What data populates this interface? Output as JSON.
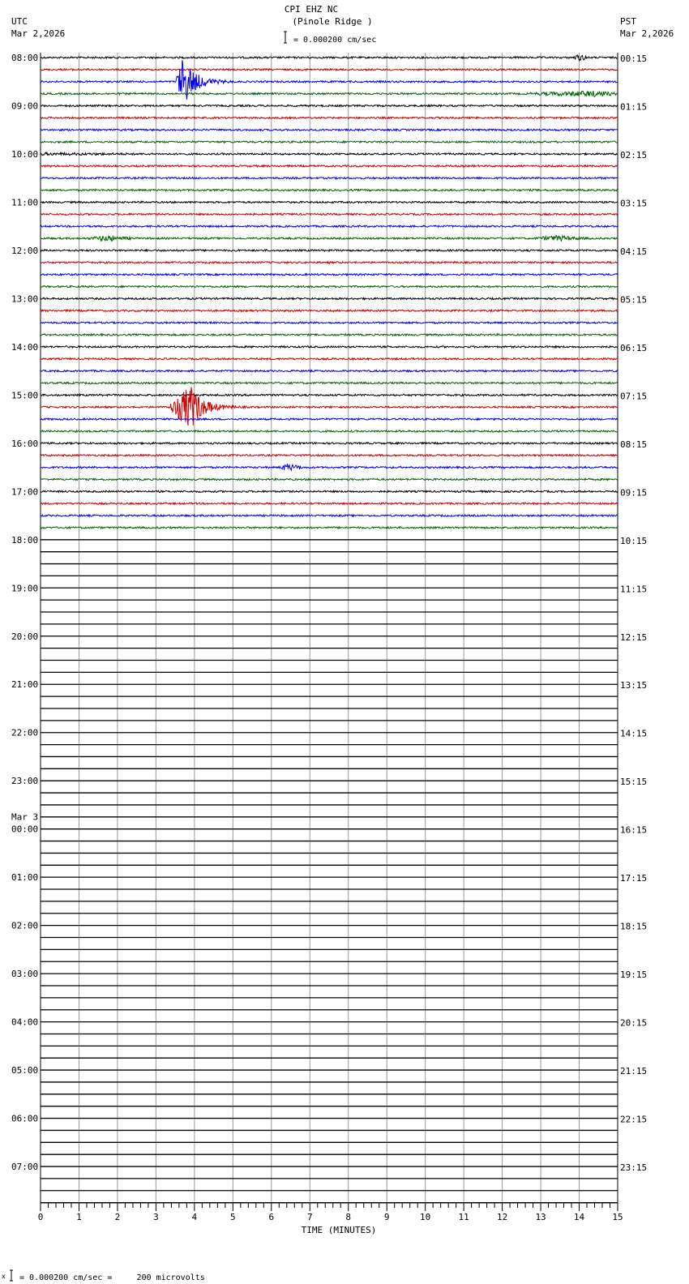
{
  "header": {
    "title": "CPI EHZ NC",
    "subtitle": "(Pinole Ridge )",
    "scale_label": "= 0.000200 cm/sec",
    "left_tz": "UTC",
    "left_date": "Mar 2,2026",
    "right_tz": "PST",
    "right_date": "Mar 2,2026"
  },
  "footer": {
    "scale_note": "= 0.000200 cm/sec =     200 microvolts",
    "marker": "x"
  },
  "chart_data": {
    "type": "line",
    "title": "CPI EHZ NC (Pinole Ridge )",
    "xlabel": "TIME (MINUTES)",
    "xlim": [
      0,
      15
    ],
    "x_ticks": [
      "0",
      "1",
      "2",
      "3",
      "4",
      "5",
      "6",
      "7",
      "8",
      "9",
      "10",
      "11",
      "12",
      "13",
      "14",
      "15"
    ],
    "lines_per_hour": 4,
    "total_lines": 96,
    "recorded_lines": 40,
    "trace_colors": [
      "#000000",
      "#cc0000",
      "#0000ee",
      "#006400"
    ],
    "left_labels": [
      "08:00",
      "09:00",
      "10:00",
      "11:00",
      "12:00",
      "13:00",
      "14:00",
      "15:00",
      "16:00",
      "17:00",
      "18:00",
      "19:00",
      "20:00",
      "21:00",
      "22:00",
      "23:00",
      "00:00",
      "01:00",
      "02:00",
      "03:00",
      "04:00",
      "05:00",
      "06:00",
      "07:00"
    ],
    "date_change_label": "Mar 3",
    "right_labels": [
      "00:15",
      "01:15",
      "02:15",
      "03:15",
      "04:15",
      "05:15",
      "06:15",
      "07:15",
      "08:15",
      "09:15",
      "10:15",
      "11:15",
      "12:15",
      "13:15",
      "14:15",
      "15:15",
      "16:15",
      "17:15",
      "18:15",
      "19:15",
      "20:15",
      "21:15",
      "22:15",
      "23:15"
    ],
    "events": [
      {
        "line_start": "08:30",
        "start_min": 3.5,
        "peak_min": 3.7,
        "end_min": 5.0,
        "amplitude": 30
      },
      {
        "line_start": "15:15",
        "start_min": 3.3,
        "peak_min": 3.9,
        "end_min": 5.3,
        "amplitude": 28
      },
      {
        "line_start": "08:00",
        "start_min": 13.8,
        "peak_min": 14.0,
        "end_min": 14.2,
        "amplitude": 3
      },
      {
        "line_start": "08:45",
        "start_min": 12.5,
        "peak_min": 14.5,
        "end_min": 15.0,
        "amplitude": 3
      },
      {
        "line_start": "11:45",
        "start_min": 1.2,
        "peak_min": 1.8,
        "end_min": 2.4,
        "amplitude": 3
      },
      {
        "line_start": "11:45",
        "start_min": 12.8,
        "peak_min": 13.5,
        "end_min": 14.3,
        "amplitude": 3
      },
      {
        "line_start": "16:30",
        "start_min": 6.2,
        "peak_min": 6.4,
        "end_min": 6.8,
        "amplitude": 4
      }
    ]
  }
}
